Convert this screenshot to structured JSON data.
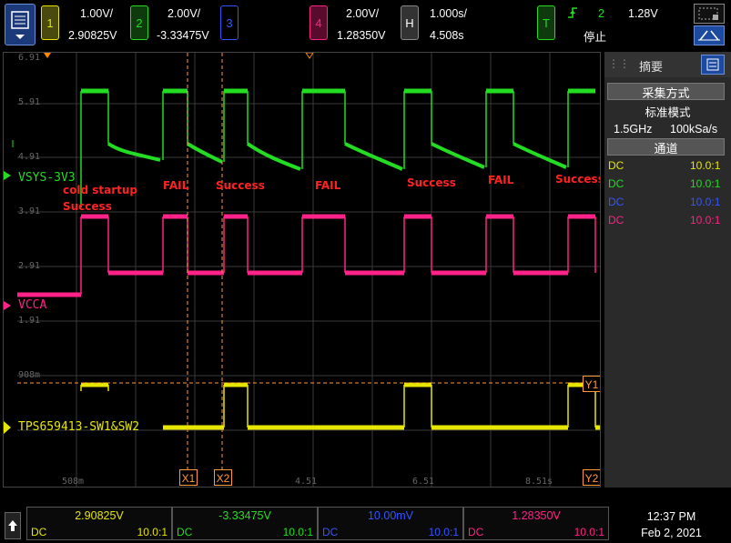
{
  "topbar": {
    "ch1": {
      "num": "1",
      "scale": "1.00V/",
      "offset": "2.90825V",
      "color": "#e6e600"
    },
    "ch2": {
      "num": "2",
      "scale": "2.00V/",
      "offset": "-3.33475V",
      "color": "#22dd22"
    },
    "ch3": {
      "num": "3",
      "color": "#3355ff"
    },
    "ch4": {
      "num": "4",
      "scale": "2.00V/",
      "offset": "1.28350V",
      "color": "#ff2288"
    },
    "horizontal": {
      "label": "H",
      "scale": "1.000s/",
      "delay": "4.508s"
    },
    "trigger": {
      "label": "T",
      "source": "2",
      "level": "1.28V",
      "status": "停止"
    }
  },
  "scope": {
    "traces": {
      "ch2_label": "VSYS-3V3",
      "ch4_label": "VCCA",
      "ch1_label": "TPS659413-SW1&SW2"
    },
    "gridlabels": [
      "6.91",
      "5.91",
      "4.91",
      "3.91",
      "2.91",
      "1.91",
      "908m"
    ],
    "time_labels": [
      "508m",
      "4.51",
      "6.51",
      "8.51s"
    ],
    "cursors": {
      "x1": "X1",
      "x2": "X2",
      "y1": "Y1",
      "y2": "Y2"
    },
    "annotations": [
      {
        "text": "cold startup"
      },
      {
        "text": "Success"
      },
      {
        "text": "FAIL"
      },
      {
        "text": "Success"
      },
      {
        "text": "FAIL"
      },
      {
        "text": "Success"
      },
      {
        "text": "FAIL"
      },
      {
        "text": "Success"
      }
    ]
  },
  "panel": {
    "title": "摘要",
    "acq_header": "采集方式",
    "acq_mode": "标准模式",
    "sample_rate": "1.5GHz",
    "mem_rate": "100kSa/s",
    "channels_header": "通道",
    "channels": [
      {
        "coupling": "DC",
        "ratio": "10.0:1",
        "color": "#e6e600"
      },
      {
        "coupling": "DC",
        "ratio": "10.0:1",
        "color": "#22dd22"
      },
      {
        "coupling": "DC",
        "ratio": "10.0:1",
        "color": "#3355ff"
      },
      {
        "coupling": "DC",
        "ratio": "10.0:1",
        "color": "#ff2288"
      }
    ]
  },
  "bottom": {
    "cells": [
      {
        "value": "2.90825V",
        "coupling": "DC",
        "ratio": "10.0:1",
        "color": "#e6e600"
      },
      {
        "value": "-3.33475V",
        "coupling": "DC",
        "ratio": "10.0:1",
        "color": "#22dd22"
      },
      {
        "value": "10.00mV",
        "coupling": "DC",
        "ratio": "10.0:1",
        "color": "#3355ff"
      },
      {
        "value": "1.28350V",
        "coupling": "DC",
        "ratio": "10.0:1",
        "color": "#ff2288"
      }
    ],
    "time": "12:37 PM",
    "date": "Feb 2, 2021"
  }
}
